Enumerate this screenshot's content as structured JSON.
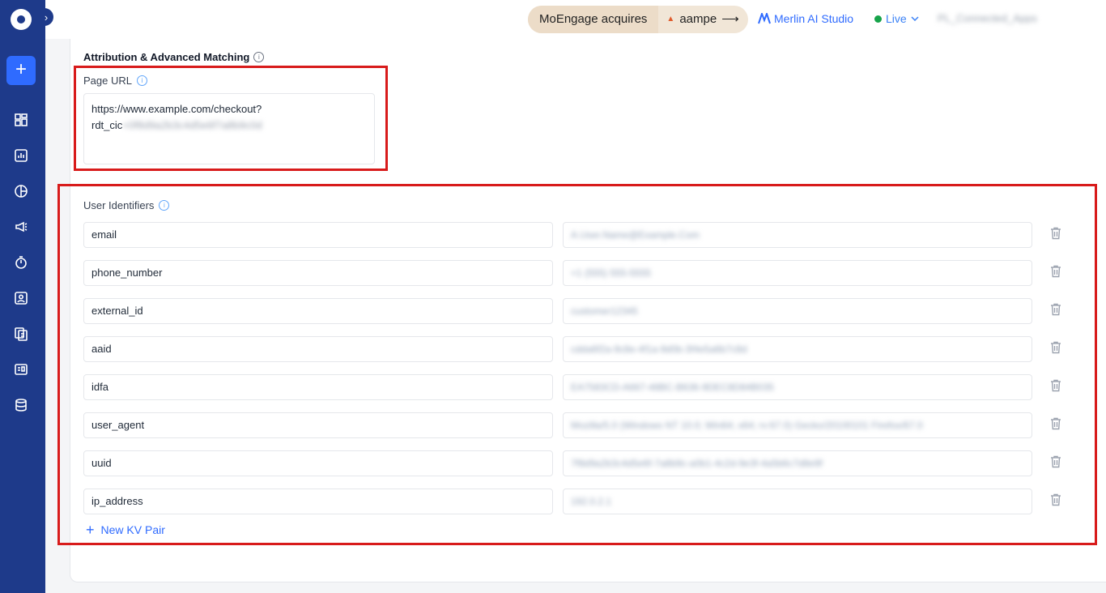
{
  "topbar": {
    "promo_left": "MoEngage acquires",
    "promo_right": "aampe",
    "promo_arrow": "⟶",
    "merlin": "Merlin AI Studio",
    "status": "Live",
    "account": "PL_Connected_Apps"
  },
  "section": {
    "title": "Attribution & Advanced Matching"
  },
  "page_url": {
    "label": "Page URL",
    "line1": "https://www.example.com/checkout?",
    "line2_prefix": "rdt_cic",
    "line2_redacted": "=0f8d9a2b3c4d5e6f7a8b9c0d"
  },
  "user_identifiers": {
    "label": "User Identifiers",
    "rows": [
      {
        "key": "email",
        "value": "A.User.Name@Example.Com"
      },
      {
        "key": "phone_number",
        "value": "+1 (555) 555-5555"
      },
      {
        "key": "external_id",
        "value": "customer12345"
      },
      {
        "key": "aaid",
        "value": "cdda6f2a-9c8e-4f1a-9d0b-3f4e5a6b7c8d"
      },
      {
        "key": "idfa",
        "value": "EA7583CD-A667-48BC-B636-9DEC8D84B035"
      },
      {
        "key": "user_agent",
        "value": "Mozilla/5.0 (Windows NT 10.0; Win64; x64; rv:67.0) Gecko/20100101 Firefox/67.0"
      },
      {
        "key": "uuid",
        "value": "7f8d9a2b3c4d5e6f-7a8b9c-a0b1-4c2d-9e3f-4a5b6c7d8e9f"
      },
      {
        "key": "ip_address",
        "value": "192.0.2.1"
      }
    ],
    "add_label": "New KV Pair"
  },
  "colors": {
    "sidebar": "#1e3a8a",
    "accent": "#2f6bff",
    "highlight": "#d81b1b",
    "live": "#16a34a"
  }
}
